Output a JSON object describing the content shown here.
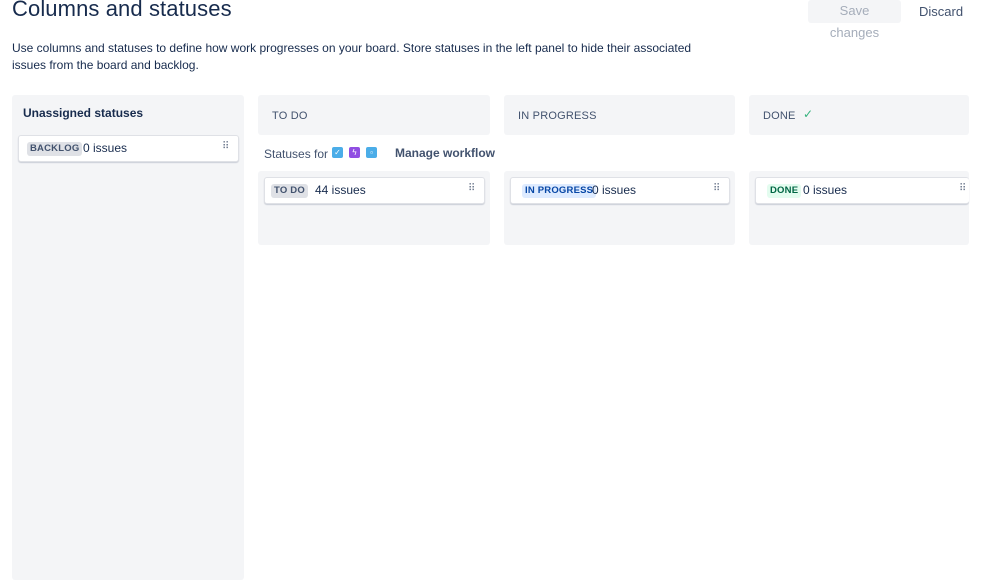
{
  "header": {
    "title": "Columns and statuses",
    "save_label": "Save changes",
    "discard_label": "Discard"
  },
  "description": "Use columns and statuses to define how work progresses on your board. Store statuses in the left panel to hide their associated issues from the board and backlog.",
  "unassigned": {
    "title": "Unassigned statuses",
    "cards": [
      {
        "status": "BACKLOG",
        "count": "0 issues"
      }
    ]
  },
  "columns": [
    {
      "name": "TO DO",
      "card": {
        "status": "TO DO",
        "count": "44 issues",
        "color": "#dfe1e6"
      }
    },
    {
      "name": "IN PROGRESS",
      "card": {
        "status": "IN PROGRESS",
        "count": "0 issues",
        "color": "#deebff"
      }
    },
    {
      "name": "DONE",
      "done_icon": "check-icon",
      "card": {
        "status": "DONE",
        "count": "0 issues",
        "color": "#e3fcef"
      }
    }
  ],
  "workflow": {
    "statuses_for_label": "Statuses for",
    "issue_type_icons": [
      {
        "name": "task-icon",
        "color": "#4bade8"
      },
      {
        "name": "subtask-icon",
        "color": "#904ee2"
      },
      {
        "name": "story-icon",
        "color": "#4bade8"
      }
    ],
    "manage_label": "Manage workflow"
  }
}
